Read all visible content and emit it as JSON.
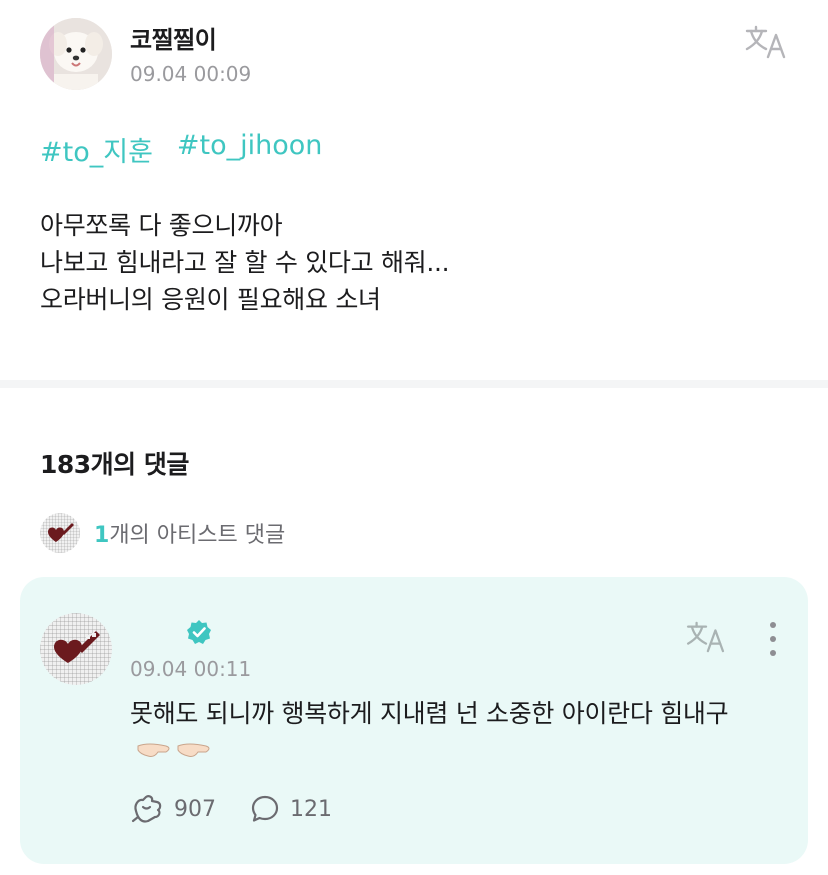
{
  "post": {
    "author": "코찔찔이",
    "time": "09.04 00:09",
    "hashtags": [
      "#to_지훈",
      "#to_jihoon"
    ],
    "body_lines": [
      "아무쪼록 다 좋으니까아",
      "나보고 힘내라고 잘 할 수 있다고 해줘...",
      "오라버니의 응원이 필요해요 소녀"
    ]
  },
  "comments": {
    "header": "183개의 댓글",
    "artist_filter": {
      "count": "1",
      "label": "개의 아티스트 댓글"
    },
    "items": [
      {
        "author": "",
        "verified": true,
        "time": "09.04 00:11",
        "text": "못해도 되니까 행복하게 지내렴 넌 소중한 아이란다 힘내구",
        "likes": "907",
        "replies": "121"
      }
    ]
  },
  "icons": {
    "translate": "translate-icon",
    "more": "more-vertical-icon",
    "like": "like-icon",
    "reply": "reply-icon",
    "verified": "verified-badge-icon"
  },
  "colors": {
    "accent": "#3fc6c1",
    "comment_card_bg": "#eaf9f7",
    "muted_text": "#9a9a9e"
  }
}
